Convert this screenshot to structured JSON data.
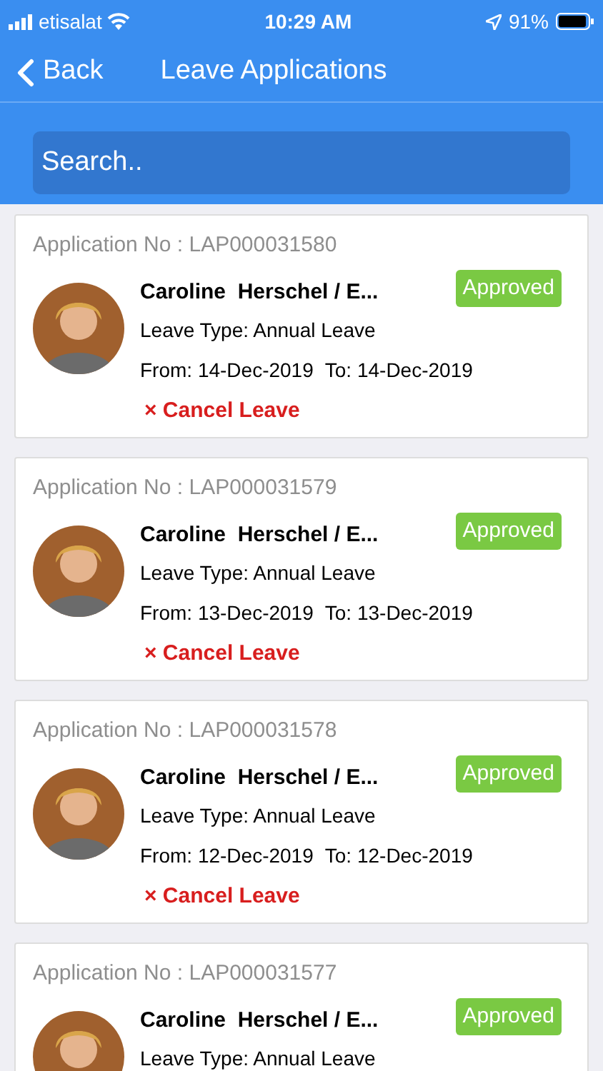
{
  "status_bar": {
    "carrier": "etisalat",
    "time": "10:29 AM",
    "battery": "91%"
  },
  "nav": {
    "back": "Back",
    "title": "Leave Applications"
  },
  "search": {
    "placeholder": "Search.."
  },
  "applications": [
    {
      "number": "Application No : LAP000031580",
      "name": "Caroline  Herschel / E...",
      "status": "Approved",
      "leave_type": "Leave Type: Annual Leave",
      "from": "From: 14-Dec-2019",
      "to": "To: 14-Dec-2019",
      "action": "× Cancel Leave"
    },
    {
      "number": "Application No : LAP000031579",
      "name": "Caroline  Herschel / E...",
      "status": "Approved",
      "leave_type": "Leave Type: Annual Leave",
      "from": "From: 13-Dec-2019",
      "to": "To: 13-Dec-2019",
      "action": "× Cancel Leave"
    },
    {
      "number": "Application No : LAP000031578",
      "name": "Caroline  Herschel / E...",
      "status": "Approved",
      "leave_type": "Leave Type: Annual Leave",
      "from": "From: 12-Dec-2019",
      "to": "To: 12-Dec-2019",
      "action": "× Cancel Leave"
    },
    {
      "number": "Application No : LAP000031577",
      "name": "Caroline  Herschel / E...",
      "status": "Approved",
      "leave_type": "Leave Type: Annual Leave"
    }
  ]
}
